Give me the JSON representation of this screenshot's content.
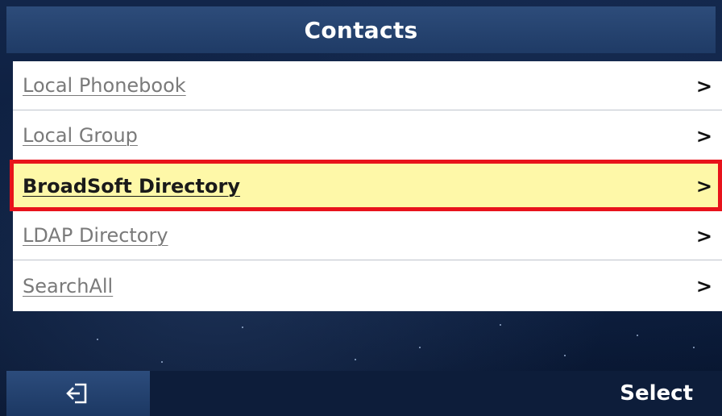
{
  "header": {
    "title": "Contacts"
  },
  "menu": {
    "items": [
      {
        "label": "Local Phonebook",
        "chevron": ">"
      },
      {
        "label": "Local Group",
        "chevron": ">"
      },
      {
        "label": "BroadSoft Directory",
        "chevron": ">",
        "selected": true
      },
      {
        "label": "LDAP Directory",
        "chevron": ">"
      },
      {
        "label": "SearchAll",
        "chevron": ">"
      }
    ]
  },
  "softkeys": {
    "back_icon": "exit-icon",
    "select_label": "Select"
  },
  "colors": {
    "selected_row": "#fef8a8",
    "highlight_border": "#e8131b",
    "header_bg": "#1f3b66"
  }
}
